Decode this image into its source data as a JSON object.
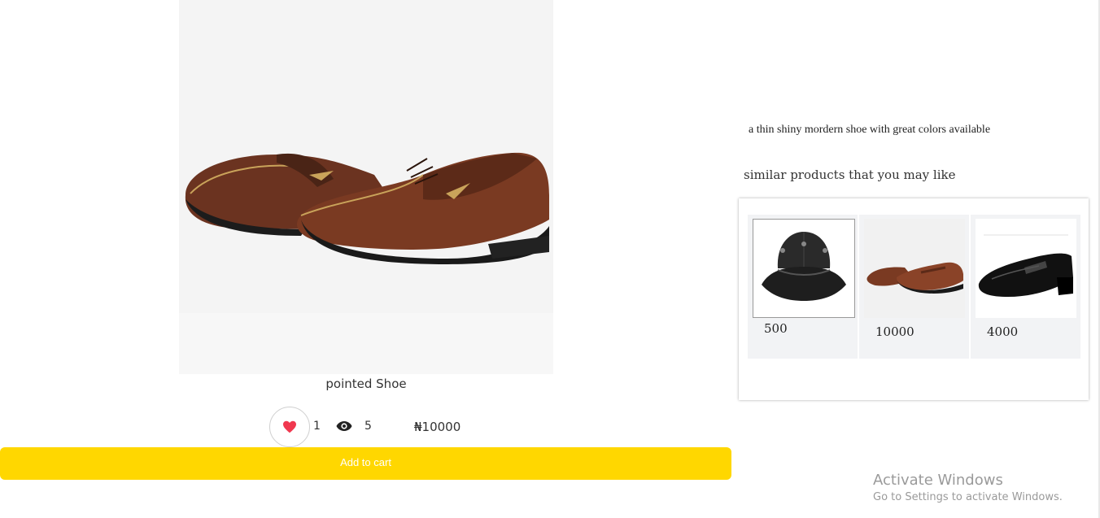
{
  "product": {
    "image_alt": "brown leather pointed shoe",
    "title": "pointed Shoe",
    "likes": "1",
    "views": "5",
    "currency": "₦",
    "price": "10000",
    "add_to_cart_label": "Add to cart"
  },
  "details": {
    "description": "a thin shiny mordern shoe with great colors available",
    "similar_heading": "similar products that you may like"
  },
  "similar_products": [
    {
      "image": "black-bucket-hat",
      "price": "500"
    },
    {
      "image": "brown-loafer-shoe",
      "price": "10000"
    },
    {
      "image": "black-slip-on-shoe",
      "price": "4000"
    }
  ],
  "icons": {
    "like": "heart-icon",
    "views": "eye-icon"
  },
  "colors": {
    "accent": "#ffd700",
    "heart": "#f0384f"
  },
  "os_overlay": {
    "title": "Activate Windows",
    "subtitle": "Go to Settings to activate Windows."
  }
}
